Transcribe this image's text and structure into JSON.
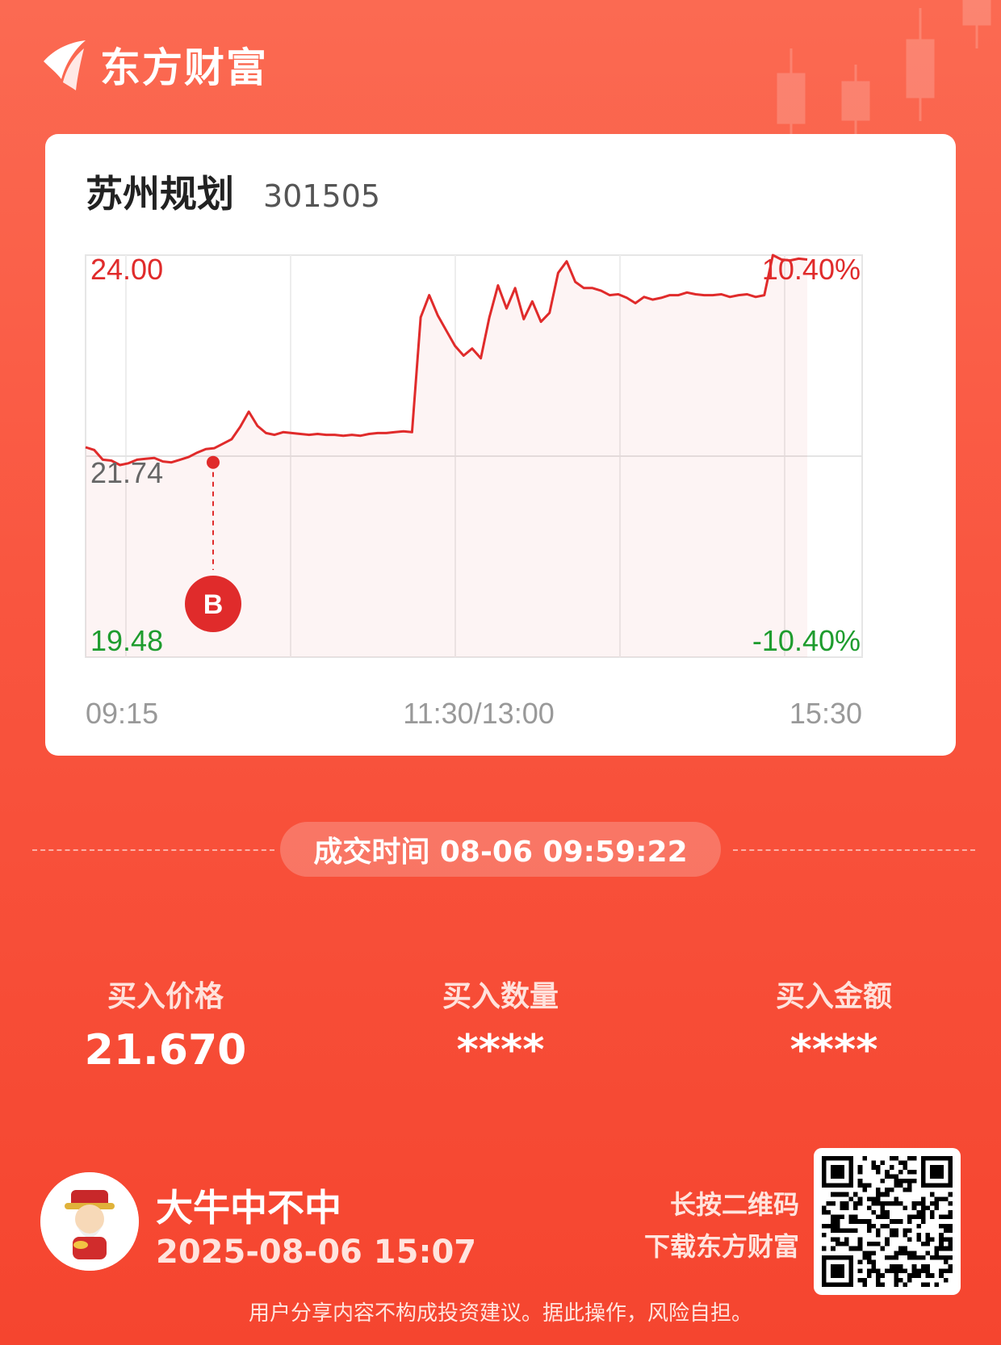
{
  "app": {
    "brand": "东方财富"
  },
  "stock": {
    "name": "苏州规划",
    "code": "301505"
  },
  "chart_data": {
    "type": "line",
    "y_max_label": "24.00",
    "y_mid_label": "21.74",
    "y_min_label": "19.48",
    "pct_max_label": "10.40%",
    "pct_min_label": "-10.40%",
    "x_labels": [
      "09:15",
      "11:30/13:00",
      "15:30"
    ],
    "ylim": [
      19.48,
      24.0
    ],
    "prev_close": 21.74,
    "series": [
      {
        "values": [
          21.84,
          21.81,
          21.7,
          21.69,
          21.64,
          21.66,
          21.7,
          21.71,
          21.72,
          21.68,
          21.67,
          21.7,
          21.73,
          21.78,
          21.82,
          21.83,
          21.88,
          21.93,
          22.07,
          22.24,
          22.08,
          22.0,
          21.98,
          22.01,
          22.0,
          21.99,
          21.98,
          21.99,
          21.98,
          21.98,
          21.97,
          21.98,
          21.97,
          21.99,
          22.0,
          22.0,
          22.01,
          22.02,
          22.01,
          23.3,
          23.55,
          23.32,
          23.15,
          22.98,
          22.87,
          22.95,
          22.84,
          23.3,
          23.66,
          23.4,
          23.63,
          23.28,
          23.48,
          23.25,
          23.35,
          23.8,
          23.93,
          23.7,
          23.63,
          23.63,
          23.6,
          23.55,
          23.56,
          23.52,
          23.46,
          23.53,
          23.5,
          23.52,
          23.55,
          23.55,
          23.58,
          23.56,
          23.55,
          23.55,
          23.56,
          23.53,
          23.55,
          23.56,
          23.53,
          23.55,
          24.0,
          23.95,
          23.94,
          23.96,
          23.95
        ]
      }
    ],
    "buy_marker": {
      "time": "09:59",
      "price": 21.67,
      "label": "B"
    }
  },
  "trade": {
    "time_label": "成交时间 08-06 09:59:22",
    "stats": [
      {
        "label": "买入价格",
        "value": "21.670"
      },
      {
        "label": "买入数量",
        "value": "****"
      },
      {
        "label": "买入金额",
        "value": "****"
      }
    ]
  },
  "footer": {
    "username": "大牛中不中",
    "share_time": "2025-08-06 15:07",
    "qr_hint_line1": "长按二维码",
    "qr_hint_line2": "下载东方财富",
    "disclaimer": "用户分享内容不构成投资建议。据此操作，风险自担。"
  },
  "colors": {
    "up": "#e02b2b",
    "down": "#1e9c2e",
    "neutral": "#666666",
    "background": "#f9553f"
  }
}
